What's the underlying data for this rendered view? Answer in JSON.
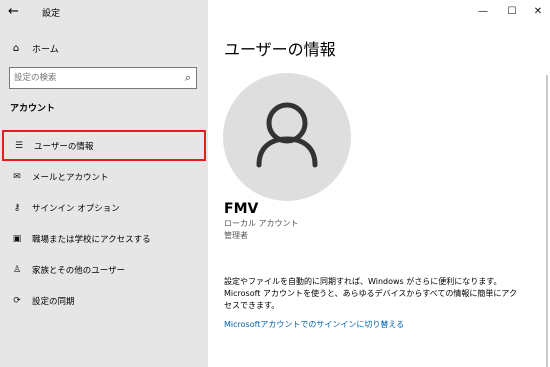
{
  "window": {
    "title": "設定",
    "back_icon": "back-arrow-icon",
    "controls": {
      "minimize": "—",
      "maximize": "☐",
      "close": "✕"
    }
  },
  "sidebar": {
    "home_label": "ホーム",
    "search_placeholder": "設定の検索",
    "section_label": "アカウント",
    "items": [
      {
        "label": "ユーザーの情報",
        "icon": "user-info-icon",
        "selected": true
      },
      {
        "label": "メールとアカウント",
        "icon": "mail-icon",
        "selected": false
      },
      {
        "label": "サインイン オプション",
        "icon": "key-icon",
        "selected": false
      },
      {
        "label": "職場または学校にアクセスする",
        "icon": "briefcase-icon",
        "selected": false
      },
      {
        "label": "家族とその他のユーザー",
        "icon": "person-add-icon",
        "selected": false
      },
      {
        "label": "設定の同期",
        "icon": "sync-icon",
        "selected": false
      }
    ]
  },
  "main": {
    "title": "ユーザーの情報",
    "user_name": "FMV",
    "account_type": "ローカル アカウント",
    "role": "管理者",
    "info_text": "設定やファイルを自動的に同期すれば、Windows がさらに便利になります。Microsoft アカウントを使うと、あらゆるデバイスからすべての情報に簡単にアクセスできます。",
    "link_label": "Microsoftアカウントでのサインインに切り替える"
  },
  "colors": {
    "sidebar_bg": "#e6e6e6",
    "selection_outline": "#e0201b",
    "link": "#0063b1",
    "avatar_bg": "#dedede"
  }
}
